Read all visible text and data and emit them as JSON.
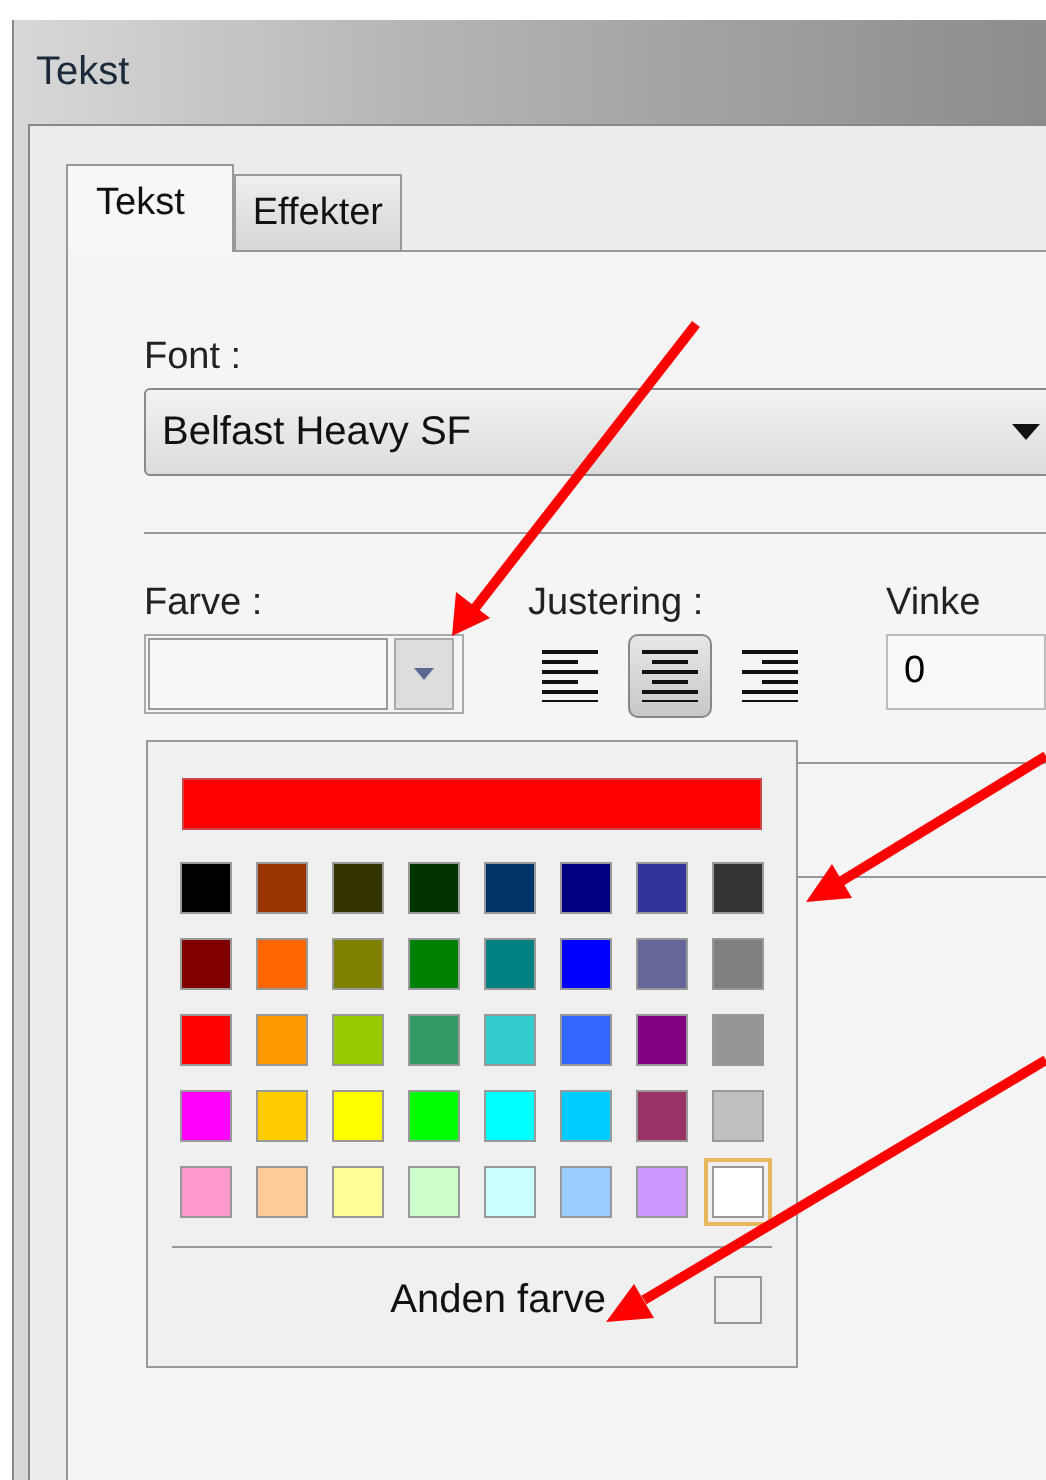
{
  "window": {
    "title": "Tekst"
  },
  "tabs": [
    {
      "label": "Tekst",
      "selected": true
    },
    {
      "label": "Effekter",
      "selected": false
    }
  ],
  "font": {
    "label": "Font :",
    "value": "Belfast Heavy SF"
  },
  "color": {
    "label": "Farve :"
  },
  "alignment": {
    "label": "Justering :",
    "buttons": [
      {
        "kind": "left",
        "selected": false
      },
      {
        "kind": "center",
        "selected": true
      },
      {
        "kind": "right",
        "selected": false
      }
    ]
  },
  "angle": {
    "label": "Vinke",
    "value": "0"
  },
  "color_popup": {
    "current": {
      "color": "#ff0000"
    },
    "swatches": [
      [
        {
          "color": "#000000",
          "selected": false
        },
        {
          "color": "#993300",
          "selected": false
        },
        {
          "color": "#333300",
          "selected": false
        },
        {
          "color": "#003300",
          "selected": false
        },
        {
          "color": "#003366",
          "selected": false
        },
        {
          "color": "#000080",
          "selected": false
        },
        {
          "color": "#333399",
          "selected": false
        },
        {
          "color": "#333333",
          "selected": false
        }
      ],
      [
        {
          "color": "#800000",
          "selected": false
        },
        {
          "color": "#ff6600",
          "selected": false
        },
        {
          "color": "#808000",
          "selected": false
        },
        {
          "color": "#008000",
          "selected": false
        },
        {
          "color": "#008080",
          "selected": false
        },
        {
          "color": "#0000ff",
          "selected": false
        },
        {
          "color": "#666699",
          "selected": false
        },
        {
          "color": "#808080",
          "selected": false
        }
      ],
      [
        {
          "color": "#ff0000",
          "selected": false
        },
        {
          "color": "#ff9900",
          "selected": false
        },
        {
          "color": "#99cc00",
          "selected": false
        },
        {
          "color": "#339966",
          "selected": false
        },
        {
          "color": "#33cccc",
          "selected": false
        },
        {
          "color": "#3366ff",
          "selected": false
        },
        {
          "color": "#800080",
          "selected": false
        },
        {
          "color": "#969696",
          "selected": false
        }
      ],
      [
        {
          "color": "#ff00ff",
          "selected": false
        },
        {
          "color": "#ffcc00",
          "selected": false
        },
        {
          "color": "#ffff00",
          "selected": false
        },
        {
          "color": "#00ff00",
          "selected": false
        },
        {
          "color": "#00ffff",
          "selected": false
        },
        {
          "color": "#00ccff",
          "selected": false
        },
        {
          "color": "#993366",
          "selected": false
        },
        {
          "color": "#c0c0c0",
          "selected": false
        }
      ],
      [
        {
          "color": "#ff99cc",
          "selected": false
        },
        {
          "color": "#ffcc99",
          "selected": false
        },
        {
          "color": "#ffff99",
          "selected": false
        },
        {
          "color": "#ccffcc",
          "selected": false
        },
        {
          "color": "#ccffff",
          "selected": false
        },
        {
          "color": "#99ccff",
          "selected": false
        },
        {
          "color": "#cc99ff",
          "selected": false
        },
        {
          "color": "#ffffff",
          "selected": true
        }
      ]
    ],
    "other_color": {
      "label": "Anden farve"
    }
  }
}
